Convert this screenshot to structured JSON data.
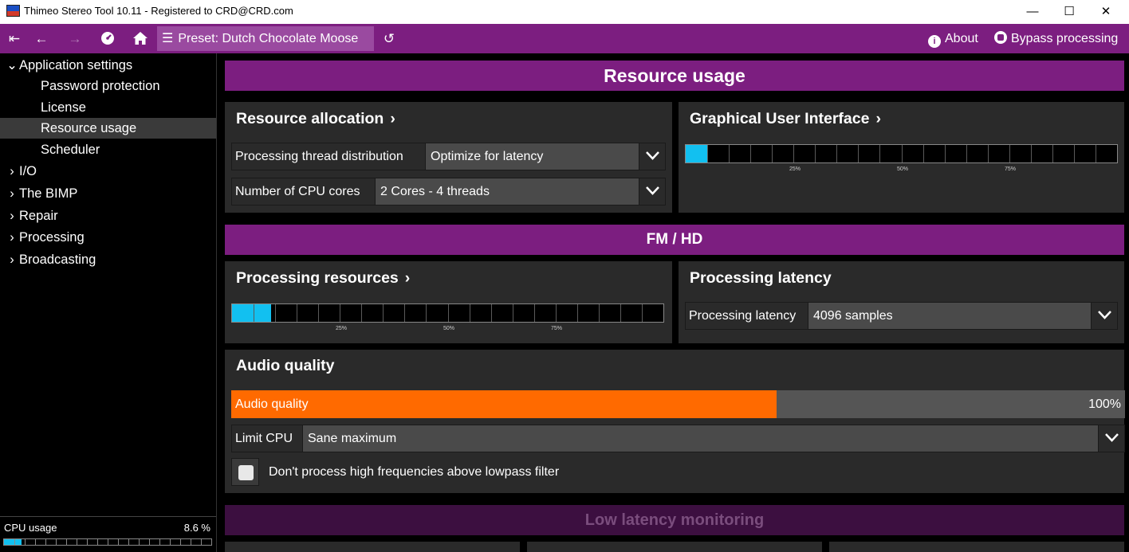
{
  "window": {
    "title": "Thimeo Stereo Tool 10.11 - Registered to CRD@CRD.com",
    "min_glyph": "—",
    "max_glyph": "☐",
    "close_glyph": "✕"
  },
  "toolbar": {
    "icons": [
      "first-icon",
      "back-icon",
      "forward-icon",
      "dashboard-icon",
      "home-icon"
    ],
    "preset_label": "Preset: Dutch Chocolate Moose",
    "about_label": "About",
    "bypass_label": "Bypass processing"
  },
  "sidebar": {
    "items": [
      {
        "label": "Application settings",
        "level": 0,
        "expanded": true
      },
      {
        "label": "Password protection",
        "level": 1
      },
      {
        "label": "License",
        "level": 1
      },
      {
        "label": "Resource usage",
        "level": 1,
        "selected": true
      },
      {
        "label": "Scheduler",
        "level": 1
      },
      {
        "label": "I/O",
        "level": 0,
        "expanded": false
      },
      {
        "label": "The BIMP",
        "level": 0,
        "expanded": false
      },
      {
        "label": "Repair",
        "level": 0,
        "expanded": false
      },
      {
        "label": "Processing",
        "level": 0,
        "expanded": false
      },
      {
        "label": "Broadcasting",
        "level": 0,
        "expanded": false
      }
    ],
    "cpu_label": "CPU usage",
    "cpu_value": "8.6 %",
    "cpu_fraction": 0.086
  },
  "main": {
    "section_resource": "Resource usage",
    "resource_allocation": {
      "title": "Resource allocation",
      "thread_label": "Processing thread distribution",
      "thread_value": "Optimize for latency",
      "cores_label": "Number of CPU cores",
      "cores_value": "2 Cores - 4 threads"
    },
    "gui": {
      "title": "Graphical User Interface",
      "usage_fraction": 0.05,
      "ticks": [
        "25%",
        "50%",
        "75%"
      ]
    },
    "section_fmhd": "FM / HD",
    "processing_resources": {
      "title": "Processing resources",
      "usage_fraction": 0.09,
      "ticks": [
        "25%",
        "50%",
        "75%"
      ]
    },
    "processing_latency": {
      "title": "Processing latency",
      "label": "Processing latency",
      "value": "4096 samples"
    },
    "audio_quality": {
      "title": "Audio quality",
      "slider_label": "Audio quality",
      "slider_value": "100%",
      "slider_fraction": 0.61,
      "limit_label": "Limit CPU",
      "limit_value": "Sane maximum",
      "checkbox_label": "Don't process high frequencies above lowpass filter",
      "checkbox_checked": false
    },
    "section_low_latency": "Low latency monitoring"
  },
  "colors": {
    "accent": "#7c1e80",
    "meter": "#12c0f0",
    "slider": "#ff6a00"
  }
}
